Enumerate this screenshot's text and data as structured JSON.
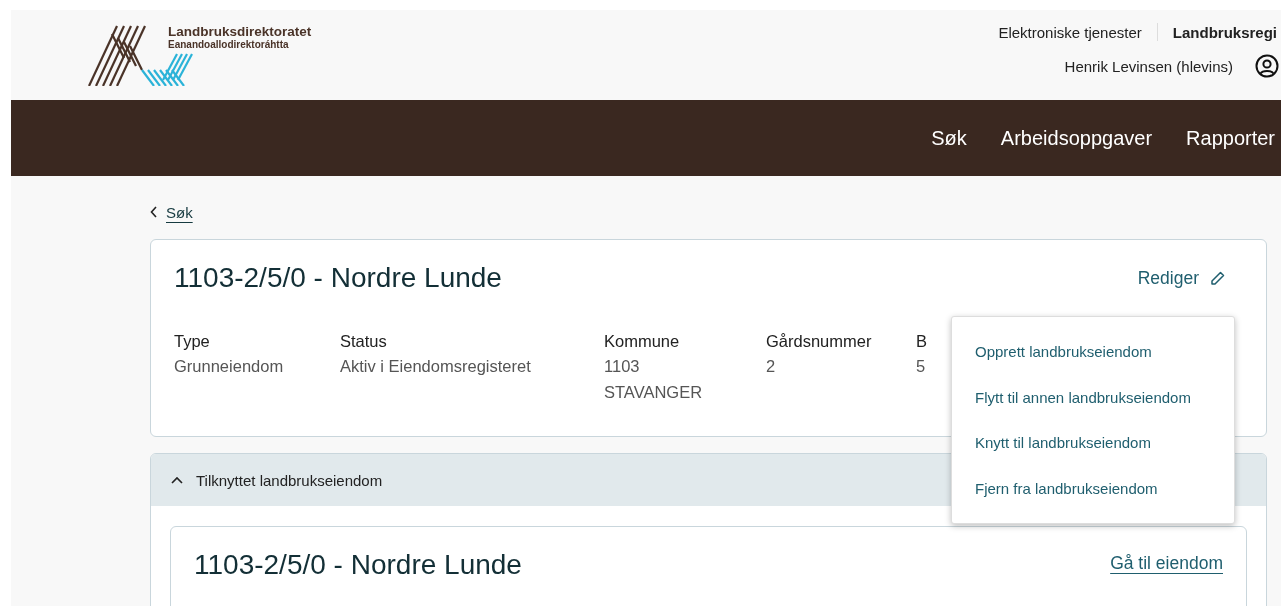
{
  "header": {
    "logo": {
      "name": "Landbruksdirektoratet",
      "subtitle": "Eanandoallodirektoráhtta"
    },
    "links": [
      {
        "label": "Elektroniske tjenester",
        "current": false
      },
      {
        "label": "Landbruksregi",
        "current": true
      }
    ],
    "user": "Henrik Levinsen (hlevins)"
  },
  "nav": [
    {
      "label": "Søk"
    },
    {
      "label": "Arbeidsoppgaver"
    },
    {
      "label": "Rapporter"
    }
  ],
  "back_link": "Søk",
  "property": {
    "title": "1103-2/5/0 - Nordre Lunde",
    "edit_button": "Rediger",
    "fields": [
      {
        "label": "Type",
        "value": [
          "Grunneiendom"
        ]
      },
      {
        "label": "Status",
        "value": [
          "Aktiv i Eiendomsregisteret"
        ]
      },
      {
        "label": "Kommune",
        "value": [
          "1103",
          "STAVANGER"
        ]
      },
      {
        "label": "Gårdsnummer",
        "value": [
          "2"
        ]
      },
      {
        "label": "B",
        "value": [
          "5"
        ]
      }
    ]
  },
  "menu": [
    "Opprett landbrukseiendom",
    "Flytt til annen landbrukseiendom",
    "Knytt til landbrukseiendom",
    "Fjern fra landbrukseiendom"
  ],
  "accordion": {
    "title": "Tilknyttet landbrukseiendom",
    "expanded": true,
    "card": {
      "title": "1103-2/5/0 - Nordre Lunde",
      "link": "Gå til eiendom"
    }
  }
}
